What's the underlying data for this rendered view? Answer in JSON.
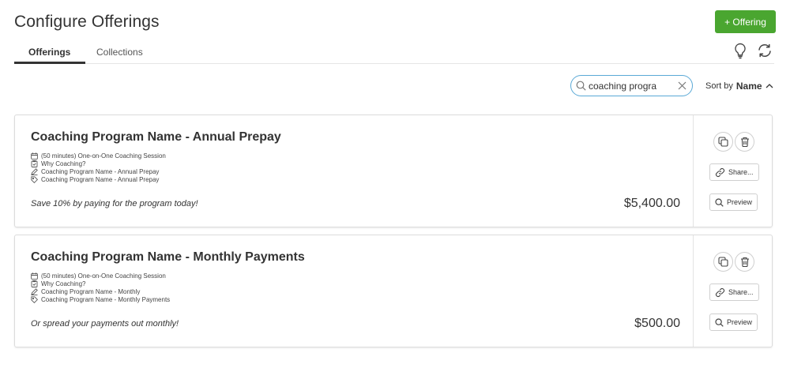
{
  "page": {
    "title": "Configure Offerings"
  },
  "header": {
    "add_button_label": "+ Offering",
    "accent_color": "#4aa630"
  },
  "tabs": [
    {
      "label": "Offerings",
      "active": true
    },
    {
      "label": "Collections",
      "active": false
    }
  ],
  "toolbar": {
    "search_value": "coaching progra",
    "sort_prefix": "Sort by",
    "sort_value": "Name",
    "sort_direction": "ascending"
  },
  "offerings": [
    {
      "title": "Coaching Program Name - Annual Prepay",
      "details": [
        {
          "icon": "calendar-icon",
          "text": "(50 minutes) One-on-One Coaching Session"
        },
        {
          "icon": "form-icon",
          "text": "Why Coaching?"
        },
        {
          "icon": "pencil-icon",
          "text": "Coaching Program Name - Annual Prepay"
        },
        {
          "icon": "tag-icon",
          "text": "Coaching Program Name - Annual Prepay"
        }
      ],
      "description": "Save 10% by paying for the program today!",
      "price": "$5,400.00",
      "share_label": "Share...",
      "preview_label": "Preview"
    },
    {
      "title": "Coaching Program Name - Monthly Payments",
      "details": [
        {
          "icon": "calendar-icon",
          "text": "(50 minutes) One-on-One Coaching Session"
        },
        {
          "icon": "form-icon",
          "text": "Why Coaching?"
        },
        {
          "icon": "pencil-icon",
          "text": "Coaching Program Name - Monthly"
        },
        {
          "icon": "tag-icon",
          "text": "Coaching Program Name - Monthly Payments"
        }
      ],
      "description": "Or spread your payments out monthly!",
      "price": "$500.00",
      "share_label": "Share...",
      "preview_label": "Preview"
    }
  ]
}
